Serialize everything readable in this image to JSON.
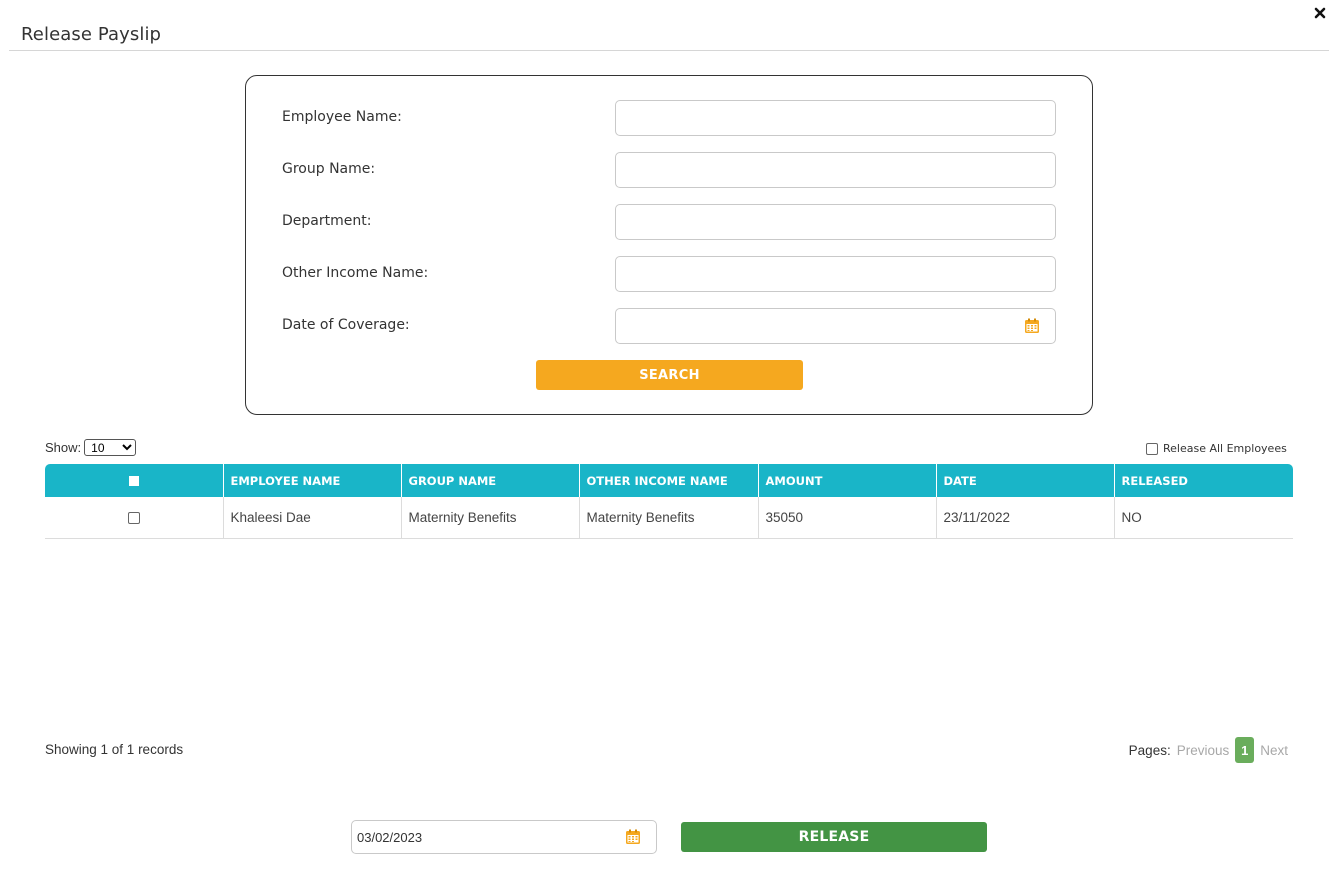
{
  "modal": {
    "title": "Release Payslip"
  },
  "icons": {
    "close": "close-icon",
    "calendar": "calendar-icon"
  },
  "colors": {
    "accent_orange": "#f5a81f",
    "table_header": "#19b5c8",
    "release_green": "#439444",
    "active_page": "#6aad5c"
  },
  "search_form": {
    "fields": [
      {
        "label": "Employee Name:",
        "value": "",
        "placeholder": ""
      },
      {
        "label": "Group Name:",
        "value": "",
        "placeholder": ""
      },
      {
        "label": "Department:",
        "value": "",
        "placeholder": ""
      },
      {
        "label": "Other Income Name:",
        "value": "",
        "placeholder": ""
      },
      {
        "label": "Date of Coverage:",
        "value": "",
        "placeholder": ""
      }
    ],
    "search_label": "SEARCH"
  },
  "table_controls": {
    "show_label": "Show:",
    "show_value": "10",
    "release_all_label": "Release All Employees"
  },
  "table": {
    "headers": [
      "EMPLOYEE NAME",
      "GROUP NAME",
      "OTHER INCOME NAME",
      "AMOUNT",
      "DATE",
      "RELEASED"
    ],
    "rows": [
      {
        "employee_name": "Khaleesi Dae",
        "group_name": "Maternity Benefits",
        "other_income_name": "Maternity Benefits",
        "amount": "35050",
        "date": "23/11/2022",
        "released": "NO"
      }
    ]
  },
  "pagination": {
    "showing_text": "Showing 1 of 1 records",
    "pages_label": "Pages:",
    "previous_label": "Previous",
    "current_page": "1",
    "next_label": "Next"
  },
  "release": {
    "date_value": "03/02/2023",
    "button_label": "RELEASE"
  }
}
